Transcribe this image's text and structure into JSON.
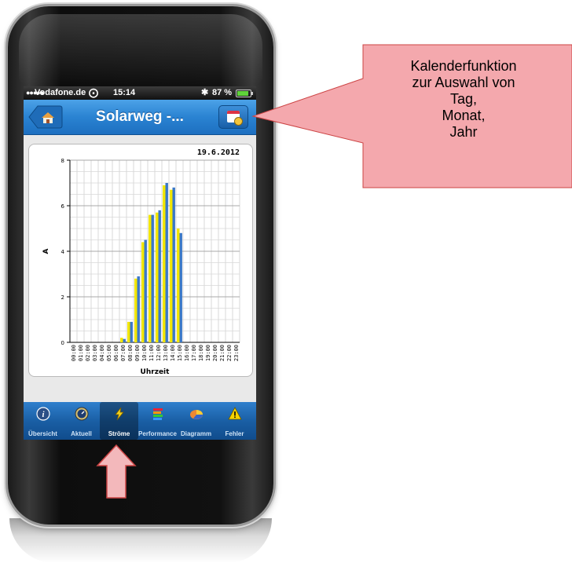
{
  "statusbar": {
    "signal": "●●●●●",
    "carrier": "Vodafone.de",
    "time": "15:14",
    "battery_text": "87 %"
  },
  "navbar": {
    "title": "Solarweg -...",
    "back_icon": "home-icon",
    "calendar_icon": "calendar-clock-icon"
  },
  "chart_data": {
    "type": "bar",
    "date_label": "19.6.2012",
    "xlabel": "Uhrzeit",
    "ylabel": "A",
    "ylim": [
      0,
      8
    ],
    "yticks": [
      0,
      2,
      4,
      6,
      8
    ],
    "categories": [
      "00:00",
      "01:00",
      "02:00",
      "03:00",
      "04:00",
      "05:00",
      "06:00",
      "07:00",
      "08:00",
      "09:00",
      "10:00",
      "11:00",
      "12:00",
      "13:00",
      "14:00",
      "15:00",
      "16:00",
      "17:00",
      "18:00",
      "19:00",
      "20:00",
      "21:00",
      "22:00",
      "23:00"
    ],
    "series": [
      {
        "color": "#f2e600",
        "values": [
          0,
          0,
          0,
          0,
          0,
          0,
          0,
          0.2,
          0.9,
          2.8,
          4.4,
          5.6,
          5.7,
          6.9,
          6.7,
          5.0,
          0,
          0,
          0,
          0,
          0,
          0,
          0,
          0
        ]
      },
      {
        "color": "#3a78c8",
        "values": [
          0,
          0,
          0,
          0,
          0,
          0,
          0,
          0.15,
          0.9,
          2.9,
          4.5,
          5.6,
          5.8,
          7.0,
          6.8,
          4.8,
          0,
          0,
          0,
          0,
          0,
          0,
          0,
          0
        ]
      }
    ],
    "grid": true
  },
  "tabs": [
    {
      "label": "Übersicht",
      "icon": "info-icon"
    },
    {
      "label": "Aktuell",
      "icon": "gauge-icon"
    },
    {
      "label": "Ströme",
      "icon": "lightning-icon"
    },
    {
      "label": "Performance",
      "icon": "stacked-bars-icon"
    },
    {
      "label": "Diagramm",
      "icon": "pie-chart-icon"
    },
    {
      "label": "Fehler",
      "icon": "warning-icon"
    }
  ],
  "callout": {
    "lines": [
      "Kalenderfunktion",
      "zur Auswahl von",
      "Tag,",
      "Monat,",
      "Jahr"
    ],
    "fill": "#f4a8ad",
    "stroke": "#c44"
  },
  "arrow": {
    "fill": "#f3b8bb",
    "stroke": "#c44"
  }
}
